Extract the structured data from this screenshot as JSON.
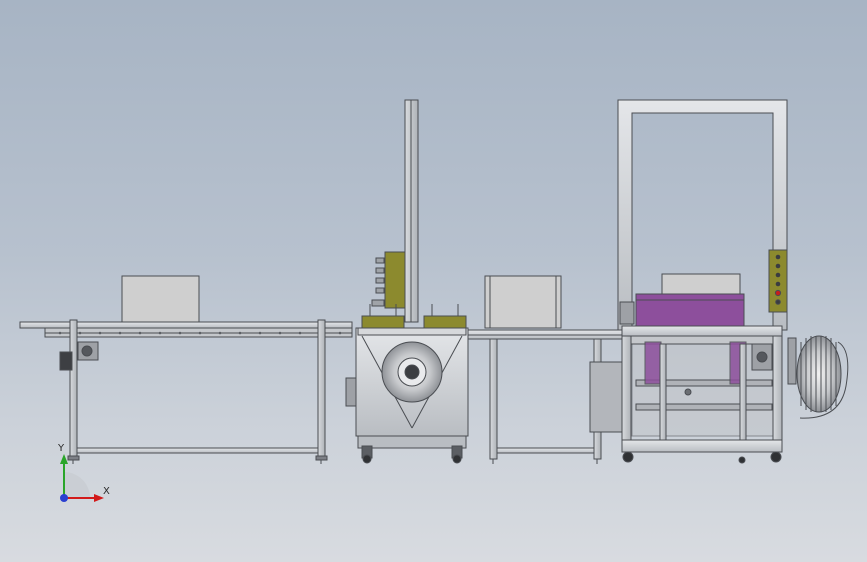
{
  "scene": {
    "name": "packaging-line-cad-front-view"
  },
  "triad": {
    "x_label": "X",
    "y_label": "Y",
    "x_color": "#d21a1a",
    "y_color": "#2aa52a",
    "z_color": "#2a3fd0"
  },
  "colors": {
    "frame": "#c9ccd0",
    "frame_edge": "#4a4d52",
    "panel": "#bfc2c6",
    "box": "#cfcfcf",
    "olive": "#8c8a2e",
    "purple": "#8d4f9c",
    "indicator_red": "#c81d1d"
  }
}
